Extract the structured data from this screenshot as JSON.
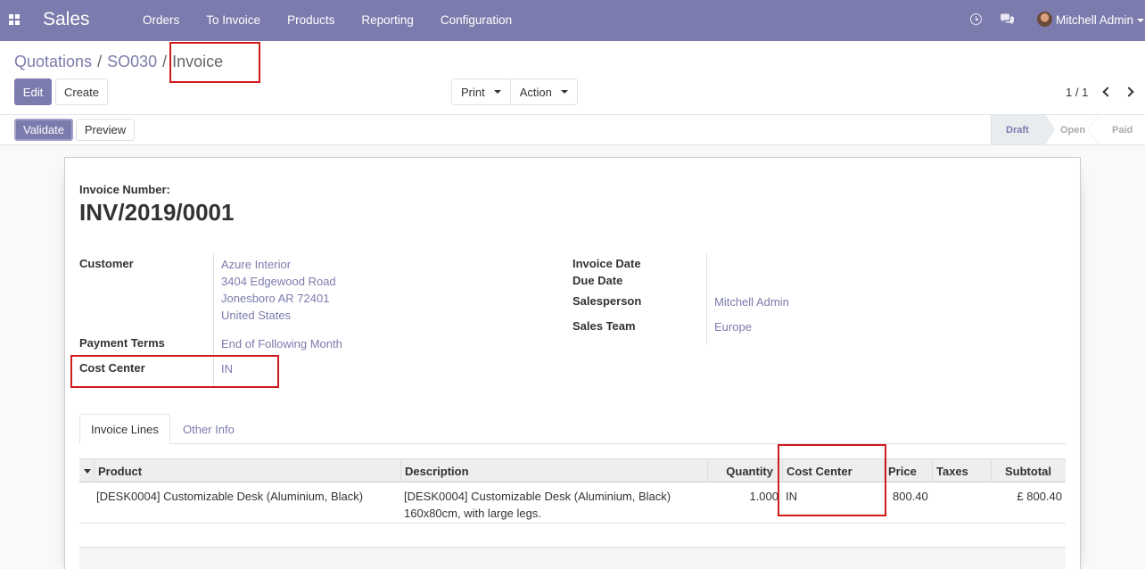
{
  "navbar": {
    "app_name": "Sales",
    "menu": [
      "Orders",
      "To Invoice",
      "Products",
      "Reporting",
      "Configuration"
    ],
    "user_name": "Mitchell Admin"
  },
  "breadcrumb": {
    "items": [
      "Quotations",
      "SO030"
    ],
    "active": "Invoice"
  },
  "toolbar": {
    "edit": "Edit",
    "create": "Create",
    "print": "Print",
    "action": "Action",
    "pager": "1 / 1"
  },
  "statusbar": {
    "validate": "Validate",
    "preview": "Preview",
    "stages": [
      "Draft",
      "Open",
      "Paid"
    ],
    "current_stage": "Draft"
  },
  "invoice": {
    "number_label": "Invoice Number:",
    "number": "INV/2019/0001",
    "customer_label": "Customer",
    "customer_lines": [
      "Azure Interior",
      "3404 Edgewood Road",
      "Jonesboro AR 72401",
      "United States"
    ],
    "payment_terms_label": "Payment Terms",
    "payment_terms": "End of Following Month",
    "cost_center_label": "Cost Center",
    "cost_center": "IN",
    "invoice_date_label": "Invoice Date",
    "invoice_date": "",
    "due_date_label": "Due Date",
    "due_date": "",
    "salesperson_label": "Salesperson",
    "salesperson": "Mitchell Admin",
    "sales_team_label": "Sales Team",
    "sales_team": "Europe"
  },
  "tabs": [
    "Invoice Lines",
    "Other Info"
  ],
  "lines_table": {
    "columns": [
      "Product",
      "Description",
      "Quantity",
      "Cost Center",
      "Price",
      "Taxes",
      "Subtotal"
    ],
    "rows": [
      {
        "product": "[DESK0004] Customizable Desk (Aluminium, Black)",
        "description_line1": "[DESK0004] Customizable Desk (Aluminium, Black)",
        "description_line2": "160x80cm, with large legs.",
        "quantity": "1.000",
        "cost_center": "IN",
        "price": "800.40",
        "taxes": "",
        "subtotal": "£ 800.40"
      }
    ]
  },
  "colors": {
    "brand": "#7c7bad",
    "highlight": "#d11a1a"
  }
}
